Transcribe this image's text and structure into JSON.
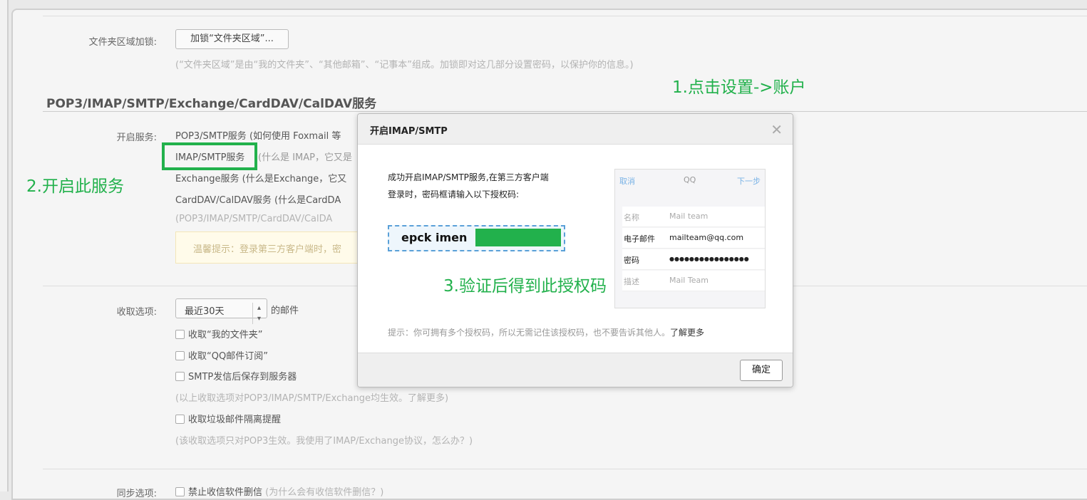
{
  "folder_lock": {
    "label": "文件夹区域加锁:",
    "button": "加锁“文件夹区域”...",
    "note": "(“文件夹区域”是由“我的文件夹”、“其他邮箱”、“记事本”组成。加锁即对这几部分设置密码，以保护你的信息。)"
  },
  "section_title": "POP3/IMAP/SMTP/Exchange/CardDAV/CalDAV服务",
  "services": {
    "label": "开启服务:",
    "items": [
      "POP3/SMTP服务 (如何使用 Foxmail 等",
      "IMAP/SMTP服务",
      "(什么是 IMAP，它又是",
      "Exchange服务 (什么是Exchange，它又",
      "CardDAV/CalDAV服务 (什么是CardDA"
    ],
    "note": "(POP3/IMAP/SMTP/CardDAV/CalDA",
    "tip": "温馨提示：登录第三方客户端时，密"
  },
  "fetch": {
    "label": "收取选项:",
    "select_value": "最近30天",
    "select_suffix": "的邮件",
    "options": [
      "收取“我的文件夹”",
      "收取“QQ邮件订阅”",
      "SMTP发信后保存到服务器"
    ],
    "note1": "(以上收取选项对POP3/IMAP/SMTP/Exchange均生效。了解更多)",
    "spam_option": "收取垃圾邮件隔离提醒",
    "note2": "(该收取选项只对POP3生效。我使用了IMAP/Exchange协议，怎么办？)"
  },
  "sync": {
    "label": "同步选项:",
    "option": "禁止收信软件删信",
    "link": "(为什么会有收信软件删信？)"
  },
  "dialog": {
    "title": "开启IMAP/SMTP",
    "msg_line1": "成功开启IMAP/SMTP服务,在第三方客户端",
    "msg_line2": "登录时，密码框请输入以下授权码:",
    "code": "epck imen",
    "phone": {
      "cancel": "取消",
      "title": "QQ",
      "next": "下一步",
      "rows": [
        [
          "名称",
          "Mail team"
        ],
        [
          "电子邮件",
          "mailteam@qq.com"
        ],
        [
          "密码",
          "●●●●●●●●●●●●●●●●"
        ],
        [
          "描述",
          "Mail Team"
        ]
      ]
    },
    "hint": "提示：你可拥有多个授权码，所以无需记住该授权码，也不要告诉其他人。",
    "hint_link": "了解更多",
    "ok": "确定"
  },
  "annotations": [
    "1.点击设置->账户",
    "2.开启此服务",
    "3.验证后得到此授权码"
  ],
  "colors": {
    "annotation": "#22b14c"
  }
}
